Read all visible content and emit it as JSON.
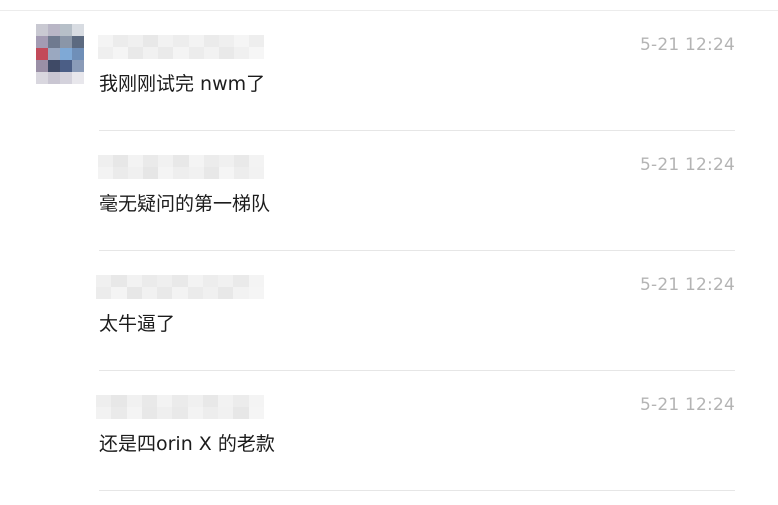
{
  "messages": [
    {
      "time": "5-21 12:24",
      "text": "我刚刚试完 nwm了"
    },
    {
      "time": "5-21 12:24",
      "text": "毫无疑问的第一梯队"
    },
    {
      "time": "5-21 12:24",
      "text": "太牛逼了"
    },
    {
      "time": "5-21 12:24",
      "text": "还是四orin X 的老款"
    }
  ],
  "colors": {
    "time": "#b4b4b4",
    "text": "#1c1c1c",
    "divider": "#e6e6e6"
  },
  "icons": {
    "avatar": "pixelated-avatar-icon"
  }
}
